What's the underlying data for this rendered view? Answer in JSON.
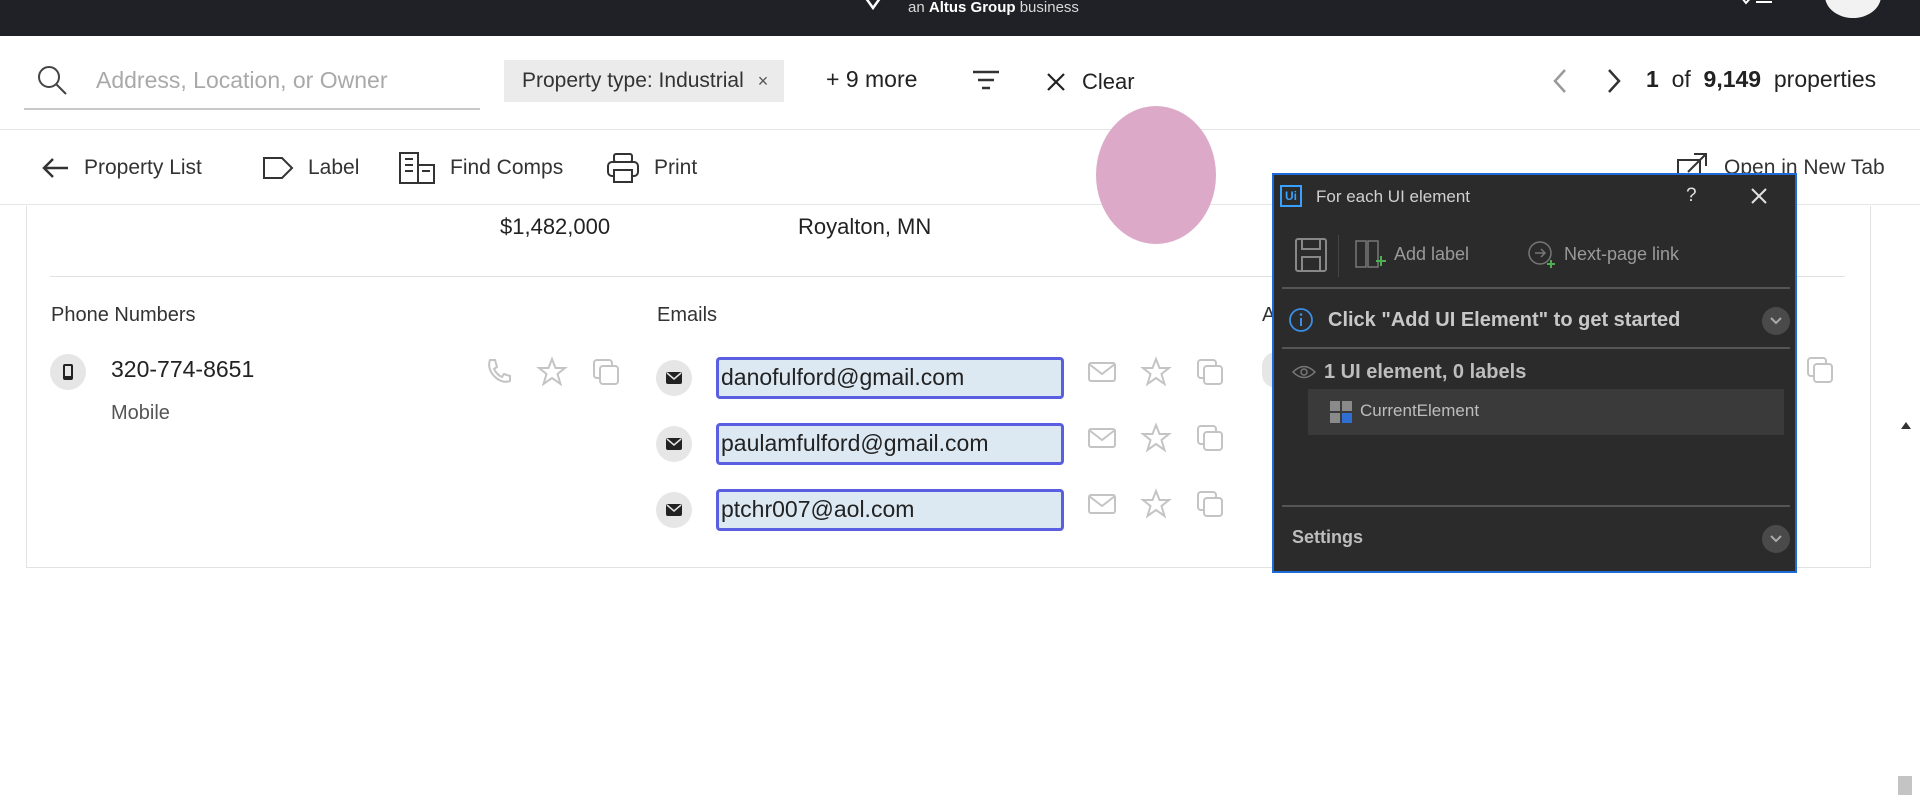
{
  "topbar": {
    "brand_prefix": "an",
    "brand_name": "Altus Group",
    "brand_suffix": "business"
  },
  "search": {
    "placeholder": "Address, Location, or Owner",
    "value": ""
  },
  "filters": {
    "chip_label": "Property type: Industrial",
    "chip_close": "×",
    "more_label": "+ 9 more",
    "clear_label": "Clear"
  },
  "pager": {
    "current": "1",
    "of": "of",
    "total": "9,149",
    "unit": "properties"
  },
  "toolbar": {
    "back_label": "Property List",
    "label_label": "Label",
    "comps_label": "Find Comps",
    "print_label": "Print",
    "open_tab_label": "Open in New Tab"
  },
  "property": {
    "price": "$1,482,000",
    "city": "Royalton, MN"
  },
  "phones": {
    "title": "Phone Numbers",
    "items": [
      {
        "number": "320-774-8651",
        "type": "Mobile"
      }
    ]
  },
  "emails": {
    "title": "Emails",
    "items": [
      {
        "address": "danofulford@gmail.com"
      },
      {
        "address": "paulamfulford@gmail.com"
      },
      {
        "address": "ptchr007@aol.com"
      }
    ]
  },
  "hidden_section": {
    "title_fragment": "A"
  },
  "panel": {
    "logo": "Ui",
    "title": "For each UI element",
    "help": "?",
    "add_label": "Add label",
    "next_page": "Next-page link",
    "info_text": "Click \"Add UI Element\" to get started",
    "count_text": "1 UI element, 0 labels",
    "tree_item": "CurrentElement",
    "settings": "Settings"
  },
  "colors": {
    "topbar_bg": "#1f2126",
    "email_highlight_border": "#5a5ee0",
    "email_highlight_bg": "#dde9f2",
    "panel_bg": "#2b2b2b",
    "panel_border": "#1e6ad6",
    "avatar_pink": "#dcaac8"
  }
}
